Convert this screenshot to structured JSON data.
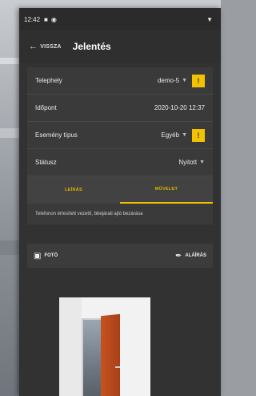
{
  "status_bar": {
    "time": "12:42"
  },
  "toolbar": {
    "back_label": "VISSZA",
    "title": "Jelentés"
  },
  "form": {
    "rows": [
      {
        "label": "Telephely",
        "value": "demo-5"
      },
      {
        "label": "Időpont",
        "value": "2020-10-20 12:37"
      },
      {
        "label": "Esemény típus",
        "value": "Egyéb"
      },
      {
        "label": "Státusz",
        "value": "Nyitott"
      }
    ],
    "warning_symbol": "!"
  },
  "tabs": [
    {
      "label": "LEÍRÁS",
      "active": false
    },
    {
      "label": "MŰVELET",
      "active": true
    }
  ],
  "description": "Telefonon értesített vezető, bbejárati ajtó bezárása",
  "actions": {
    "photo_label": "FOTÓ",
    "sign_label": "ALÁÍRÁS"
  },
  "colors": {
    "accent": "#f2c200",
    "background": "#323232"
  }
}
